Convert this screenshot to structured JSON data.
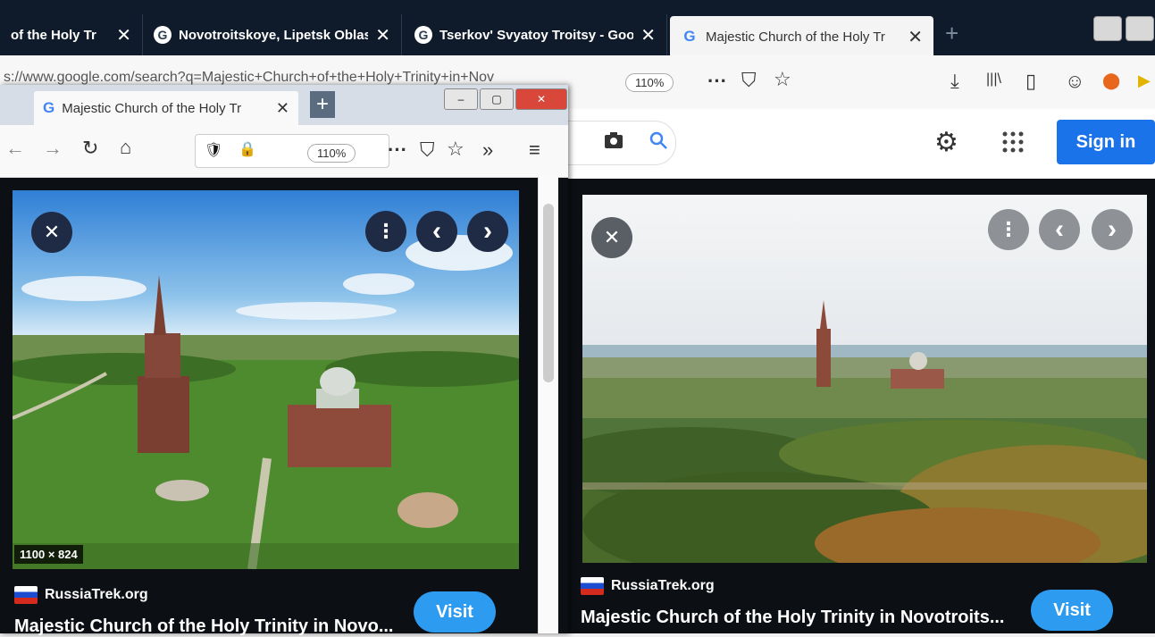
{
  "back_window": {
    "tabs": [
      {
        "label": "of the Holy Tr",
        "state": "background"
      },
      {
        "label": "Novotroitskoye, Lipetsk Oblast",
        "state": "background"
      },
      {
        "label": "Tserkov' Svyatoy Troitsy - Goo",
        "state": "background"
      },
      {
        "label": "Majestic Church of the Holy Tr",
        "state": "active"
      }
    ],
    "tab_close_glyph": "✕",
    "new_tab_glyph": "+",
    "url": "s://www.google.com/search?q=Majestic+Church+of+the+Holy+Trinity+in+Nov",
    "zoom": "110%",
    "toolbar_glyphs": {
      "more": "···",
      "pocket": "⛉",
      "star": "☆",
      "download": "⤓",
      "library": "|||\\",
      "sidebar": "▯",
      "account": "☺",
      "addon": "⬤"
    },
    "sign_in_label": "Sign in",
    "settings_glyph": "⚙",
    "apps_glyph": "⋮⋮⋮",
    "camera_glyph": "📷",
    "search_glyph": "🔍"
  },
  "front_window": {
    "tab_label": "Majestic Church of the Holy Tr",
    "tab_close_glyph": "✕",
    "new_tab_glyph": "+",
    "window_buttons": {
      "minimize": "‒",
      "maximize": "▢",
      "close": "✕"
    },
    "nav_glyphs": {
      "back": "←",
      "forward": "→",
      "reload": "↻",
      "home": "⌂"
    },
    "zoom": "110%",
    "toolbar_glyphs": {
      "more": "···",
      "pocket": "⛉",
      "star": "☆",
      "overflow": "»",
      "menu": "≡"
    }
  },
  "viewer_left": {
    "close_glyph": "✕",
    "more_glyph": "⋮",
    "prev_glyph": "‹",
    "next_glyph": "›",
    "dimensions": "1100 × 824",
    "source": "RussiaTrek.org",
    "title": "Majestic Church of the Holy Trinity in Novo...",
    "visit_label": "Visit"
  },
  "viewer_right": {
    "close_glyph": "✕",
    "more_glyph": "⋮",
    "prev_glyph": "‹",
    "next_glyph": "›",
    "source": "RussiaTrek.org",
    "title": "Majestic Church of the Holy Trinity in Novotroits...",
    "visit_label": "Visit"
  },
  "colors": {
    "tabstrip_dark": "#0f1b2b",
    "sign_in_blue": "#1a73e8",
    "visit_blue": "#2c9bf0",
    "viewer_bg": "#0c0f14"
  }
}
